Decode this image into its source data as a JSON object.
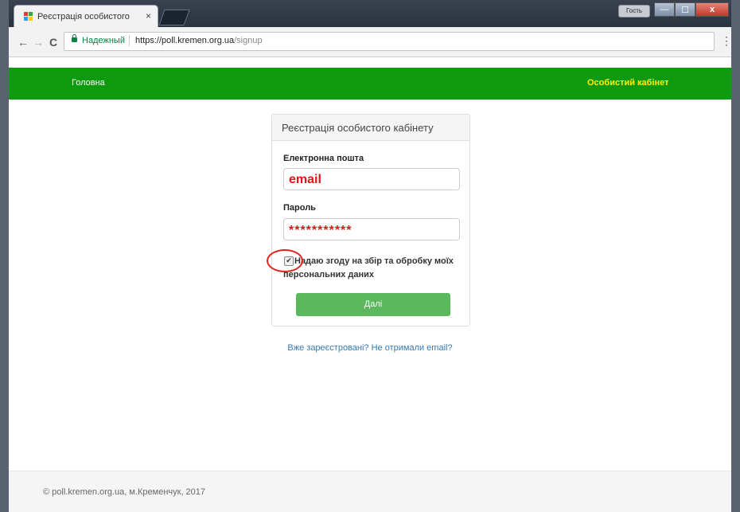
{
  "browser": {
    "tab_title": "Реєстрація особистого",
    "tab_close": "×",
    "guest_label": "Гость",
    "window_buttons": {
      "minimize": "—",
      "maximize": "☐",
      "close": "x"
    },
    "nav": {
      "back": "←",
      "forward": "→",
      "reload": "C"
    },
    "secure_label": "Надежный",
    "url_host": "https://poll.kremen.org.ua",
    "url_path": "/signup",
    "menu": "⋮"
  },
  "sitenav": {
    "home": "Головна",
    "cabinet": "Особистий кабінет"
  },
  "form": {
    "title": "Реєстрація особистого кабінету",
    "email_label": "Електронна пошта",
    "email_value": "email",
    "password_label": "Пароль",
    "password_value": "***********",
    "checkbox_mark": "✔",
    "checkbox_checked": true,
    "consent_text": "Надаю згоду на збір та обробку моїх персональних даних",
    "submit_label": "Далі"
  },
  "login_link": "Вже зареєстровані? Не отримали email?",
  "footer": "© poll.kremen.org.ua, м.Кременчук, 2017",
  "colors": {
    "nav_green": "#0e9a0e",
    "cabinet_yellow": "#ffee00",
    "button_green": "#5cb85c",
    "annotation_red": "#e5211f",
    "link_blue": "#337ab7"
  }
}
